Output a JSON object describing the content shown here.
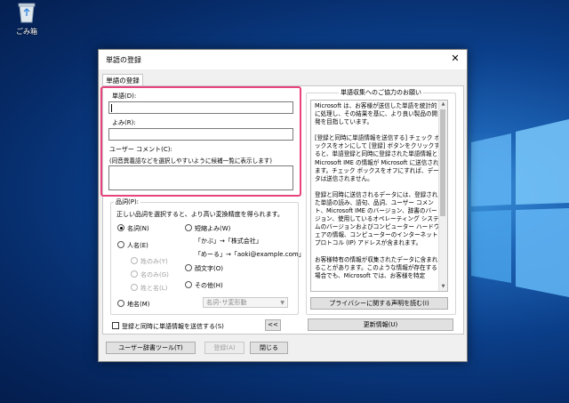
{
  "desktop": {
    "recycle_bin_label": "ごみ箱"
  },
  "dialog": {
    "title": "単語の登録",
    "tab_label": "単語の登録",
    "word_label": "単語(D):",
    "reading_label": "よみ(R):",
    "comment_label": "ユーザー コメント(C):",
    "comment_hint": "(同音異義語などを選択しやすいように候補一覧に表示します)",
    "pos_group_title": "品詞(P):",
    "pos_hint": "正しい品詞を選択すると、より高い変換精度を得られます。",
    "pos_options": {
      "noun": "名詞(N)",
      "person": "人名(E)",
      "surname_first": "姓のみ(Y)",
      "given_only": "名のみ(G)",
      "surname_given": "姓と名(L)",
      "place": "地名(M)",
      "abbrev": "短縮よみ(W)",
      "abbrev_example1": "「かぶ」→「株式会社」",
      "abbrev_example2": "「めーる」→「aoki@example.com」",
      "emoticon": "顔文字(O)",
      "other": "その他(H)"
    },
    "dropdown_value": "名詞･サ変形動",
    "send_checkbox_label": "登録と同時に単語情報を送信する(S)",
    "collapse_button": "<<",
    "user_dict_button": "ユーザー辞書ツール(T)",
    "register_button": "登録(A)",
    "close_button": "閉じる",
    "info_group_title": "単語収集へのご協力のお願い",
    "info_paragraphs": [
      "Microsoft は、お客様が送信した単語を統計的に処理し、その結果を基に、より良い製品の開発を目指しています。",
      "[登録と同時に単語情報を送信する] チェック ボックスをオンにして [登録] ボタンをクリックすると、単語登録と同時に登録された単語情報と Microsoft IME の情報が Microsoft に送信されます。チェック ボックスをオフにすれば、データは送信されません。",
      "登録と同時に送信されるデータには、登録された単語の読み、語句、品詞、ユーザー コメント、Microsoft IME のバージョン、辞書のバージョン、使用しているオペレーティング システムのバージョンおよびコンピューター ハードウェアの情報、コンピューターのインターネット プロトコル (IP) アドレスが含まれます。",
      "お客様特有の情報が収集されたデータに含まれることがあります。このような情報が存在する場合でも、Microsoft では、お客様を特定"
    ],
    "privacy_button": "プライバシーに関する声明を読む(I)",
    "update_button": "更新情報(U)"
  }
}
